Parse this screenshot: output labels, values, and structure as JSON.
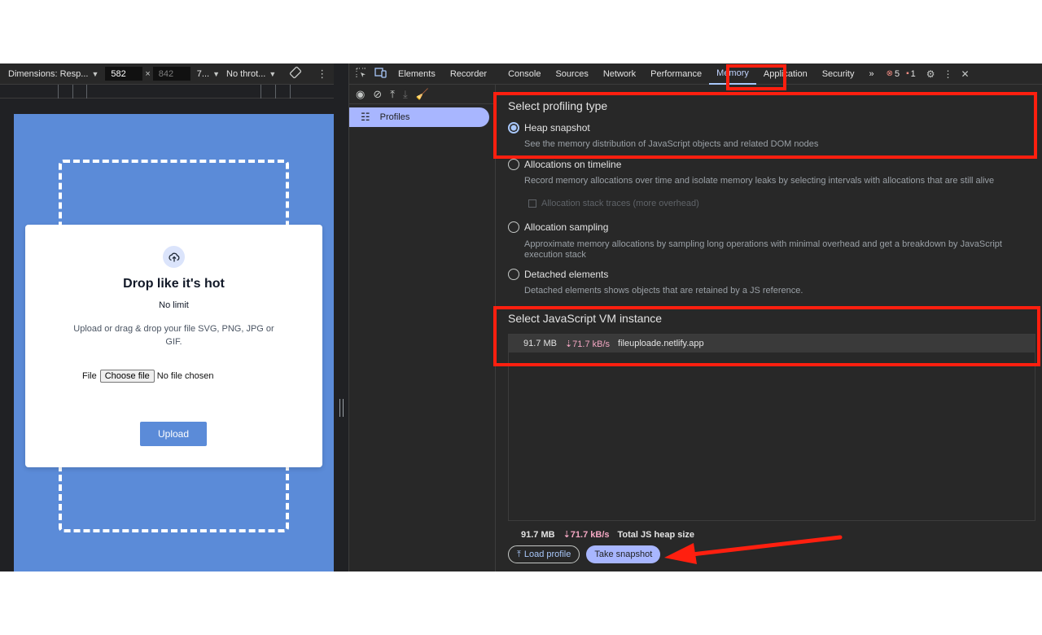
{
  "device_toolbar": {
    "dimensions_label": "Dimensions: Resp...",
    "width_value": "582",
    "times": "×",
    "height_value": "842",
    "zoom_label": "7...",
    "throttle_label": "No throt...",
    "arrow": "▼"
  },
  "page": {
    "title": "Drop like it's hot",
    "limit": "No limit",
    "description": "Upload or drag & drop your file SVG, PNG, JPG or GIF.",
    "file_label": "File",
    "choose_button": "Choose file",
    "no_file": "No file chosen",
    "upload_button": "Upload"
  },
  "devtools": {
    "tabs": [
      "Elements",
      "Recorder",
      "Console",
      "Sources",
      "Network",
      "Performance",
      "Memory",
      "Application",
      "Security"
    ],
    "more": "»",
    "errors_count": "5",
    "issues_count": "1"
  },
  "sidebar": {
    "profiles_label": "Profiles"
  },
  "memory": {
    "profiling_title": "Select profiling type",
    "options": [
      {
        "label": "Heap snapshot",
        "description": "See the memory distribution of JavaScript objects and related DOM nodes",
        "checked": true
      },
      {
        "label": "Allocations on timeline",
        "description": "Record memory allocations over time and isolate memory leaks by selecting intervals with allocations that are still alive",
        "checked": false
      },
      {
        "label": "Allocation sampling",
        "description": "Approximate memory allocations by sampling long operations with minimal overhead and get a breakdown by JavaScript execution stack",
        "checked": false
      },
      {
        "label": "Detached elements",
        "description": "Detached elements shows objects that are retained by a JS reference.",
        "checked": false
      }
    ],
    "stack_traces_label": "Allocation stack traces (more overhead)",
    "vm_title": "Select JavaScript VM instance",
    "vm_instance": {
      "size": "91.7 MB",
      "speed": "⇣71.7 kB/s",
      "host": "fileuploade.netlify.app"
    },
    "footer": {
      "size": "91.7 MB",
      "speed": "⇣71.7 kB/s",
      "label": "Total JS heap size"
    },
    "load_button": "Load profile",
    "snapshot_button": "Take snapshot"
  },
  "colors": {
    "annotation": "#ff1f0f",
    "accent": "#a8b6ff",
    "page_blue": "#5b8bd8"
  }
}
